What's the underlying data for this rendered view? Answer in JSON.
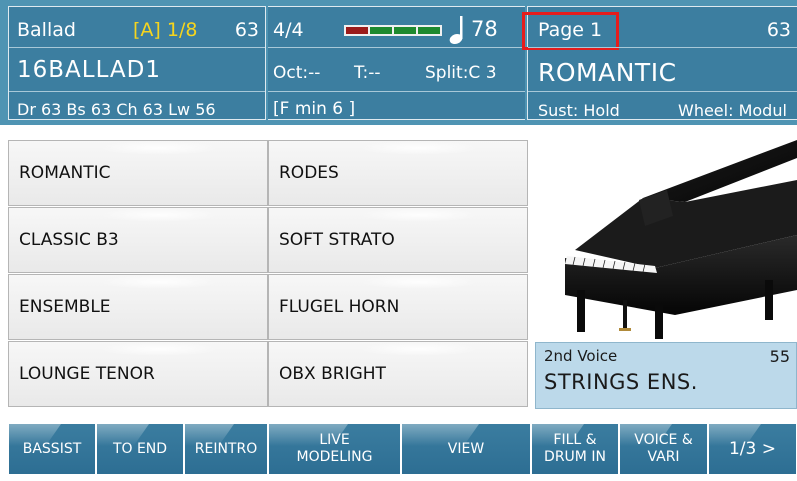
{
  "style": {
    "name": "Ballad",
    "variation": "[A] 1/8",
    "number": "63",
    "full_name": "16BALLAD1",
    "volumes": "Dr 63  Bs 63  Ch 63  Lw 56"
  },
  "status": {
    "time_signature": "4/4",
    "beat_colors": [
      "#9b1b1b",
      "#1f8a2f",
      "#1f8a2f",
      "#1f8a2f"
    ],
    "tempo": "78",
    "octave": "Oct:--",
    "transpose": "T:--",
    "split": "Split:C 3",
    "chord": "[F min 6        ]"
  },
  "voice": {
    "page": "Page 1",
    "number": "63",
    "name": "ROMANTIC",
    "sustain": "Sust: Hold",
    "wheel": "Wheel: Modul"
  },
  "voice_grid": [
    [
      "ROMANTIC",
      "RODES"
    ],
    [
      "CLASSIC B3",
      "SOFT STRATO"
    ],
    [
      "ENSEMBLE",
      "FLUGEL HORN"
    ],
    [
      "LOUNGE TENOR",
      "OBX BRIGHT"
    ]
  ],
  "picture": {
    "icon": "grand-piano-image"
  },
  "second_voice": {
    "label": "2nd Voice",
    "number": "55",
    "name": "STRINGS ENS."
  },
  "bottom_tabs": [
    "BASSIST",
    "TO END",
    "REINTRO",
    "LIVE\nMODELING",
    "VIEW",
    "FILL &\nDRUM IN",
    "VOICE &\nVARI",
    "1/3 >"
  ],
  "colors": {
    "header_bg": "#4f94b3",
    "panel_bg": "#3c7ea0",
    "accent_yellow": "#f7d51d",
    "highlight_red": "#e51d1d",
    "tab_bg": "#2d6e93"
  }
}
